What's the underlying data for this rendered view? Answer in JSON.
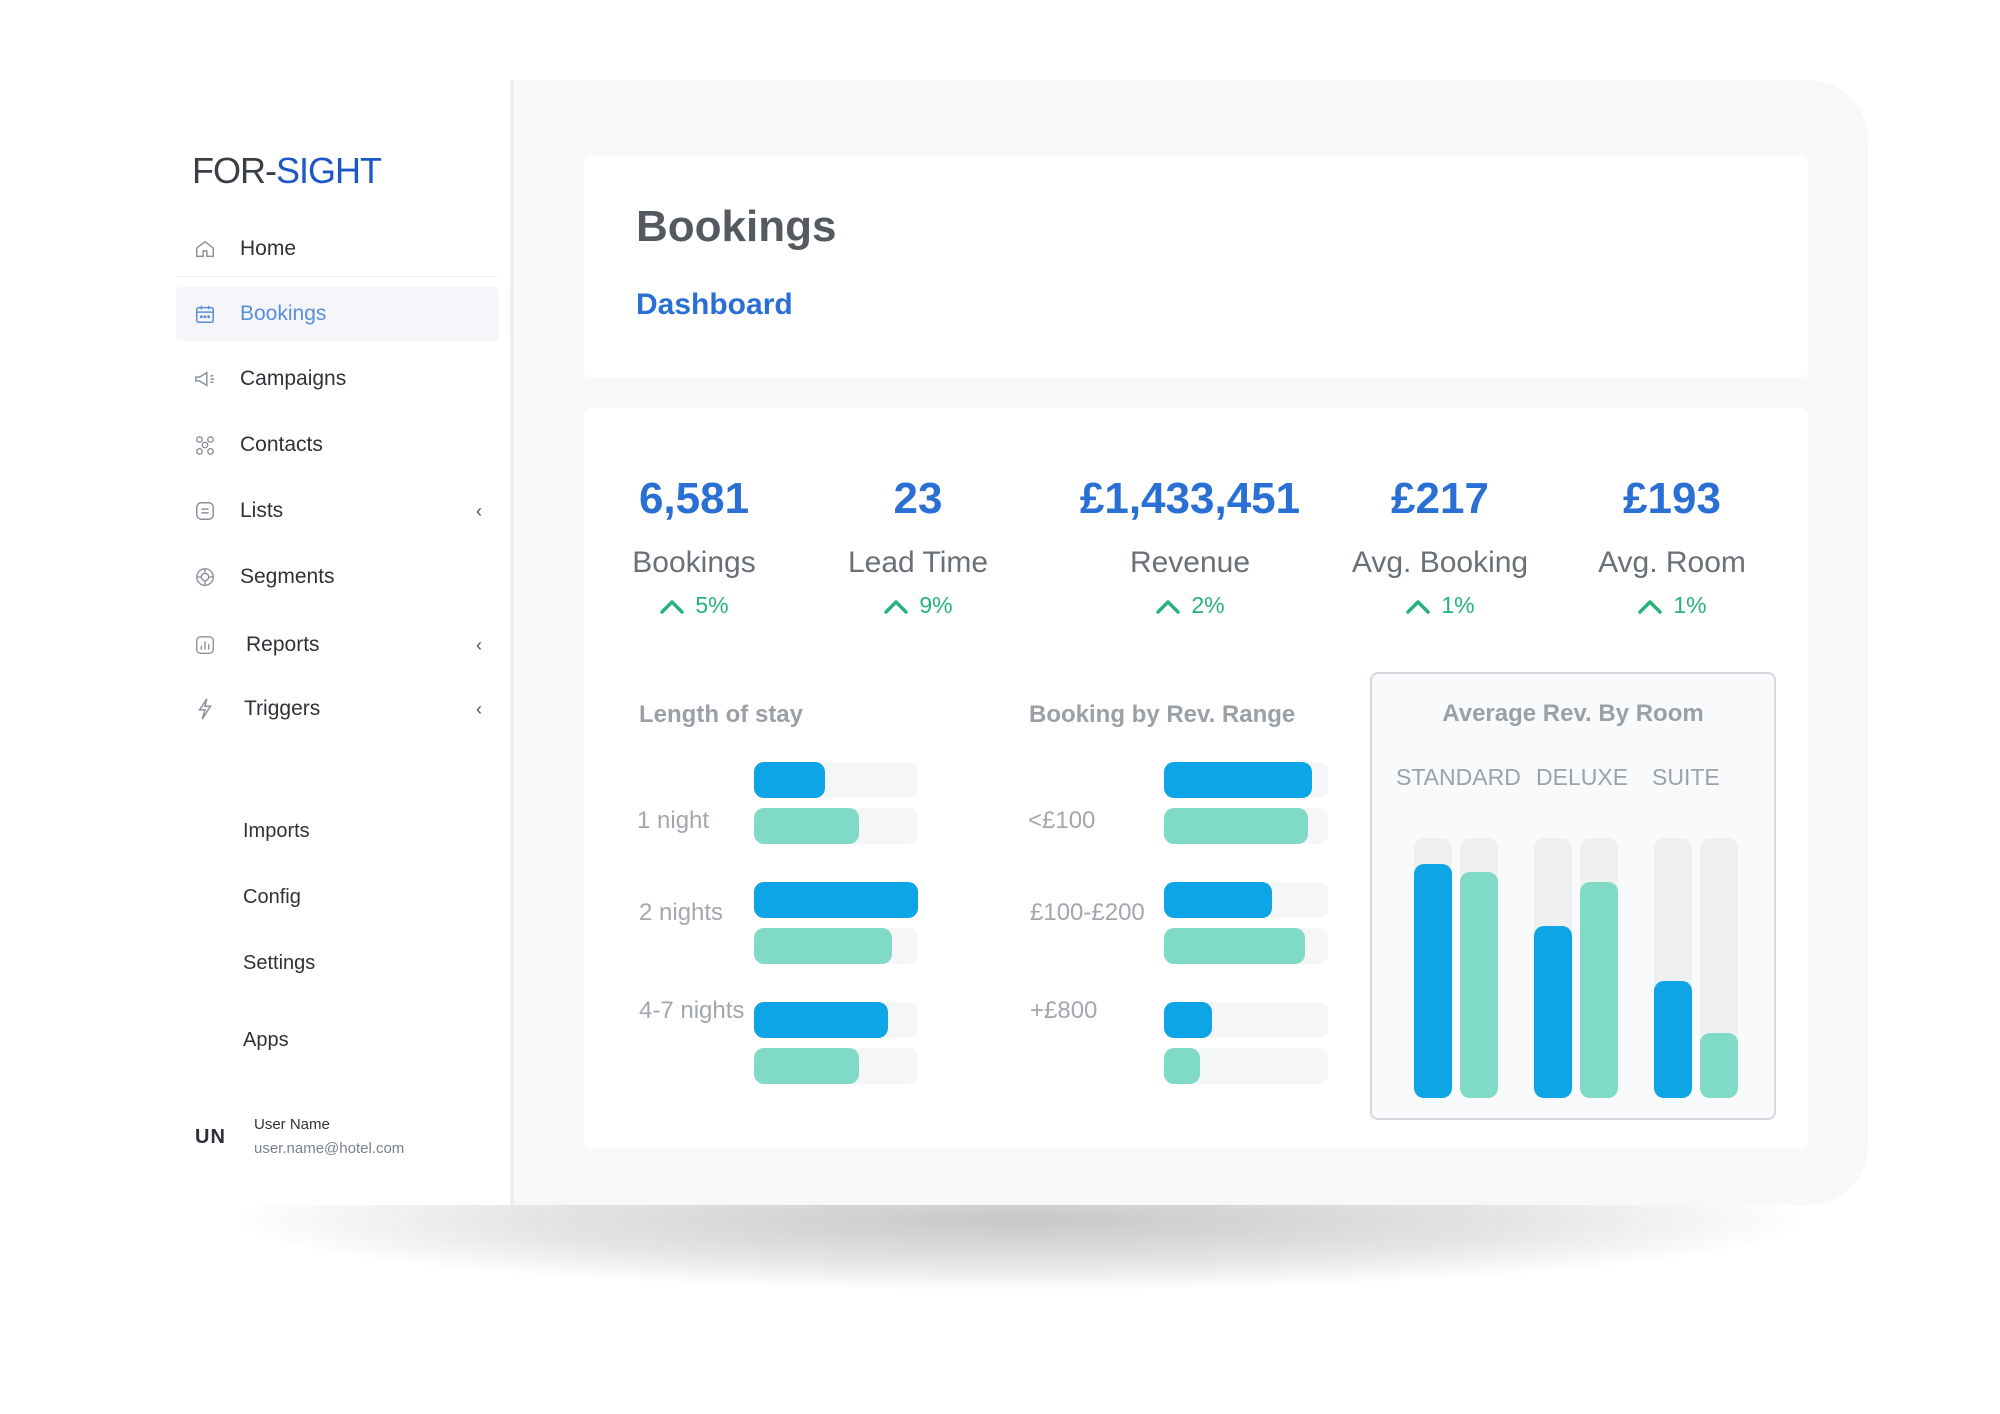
{
  "brand": {
    "part1": "FOR",
    "sep": "-",
    "part2": "SIGHT"
  },
  "nav": [
    {
      "label": "Home",
      "icon": "home-icon",
      "active": false,
      "chevron": false
    },
    {
      "label": "Bookings",
      "icon": "calendar-icon",
      "active": true,
      "chevron": false
    },
    {
      "label": "Campaigns",
      "icon": "megaphone-icon",
      "active": false,
      "chevron": false
    },
    {
      "label": "Contacts",
      "icon": "contacts-icon",
      "active": false,
      "chevron": false
    },
    {
      "label": "Lists",
      "icon": "list-icon",
      "active": false,
      "chevron": true
    },
    {
      "label": "Segments",
      "icon": "segments-icon",
      "active": false,
      "chevron": false
    },
    {
      "label": "Reports",
      "icon": "reports-icon",
      "active": false,
      "chevron": true
    },
    {
      "label": "Triggers",
      "icon": "lightning-icon",
      "active": false,
      "chevron": true
    }
  ],
  "nav_secondary": [
    "Imports",
    "Config",
    "Settings",
    "Apps"
  ],
  "chevron_glyph": "‹",
  "user": {
    "initials": "UN",
    "name": "User Name",
    "email": "user.name@hotel.com"
  },
  "header": {
    "title": "Bookings",
    "subtitle": "Dashboard"
  },
  "kpis": [
    {
      "value": "6,581",
      "label": "Bookings",
      "delta": "5%"
    },
    {
      "value": "23",
      "label": "Lead Time",
      "delta": "9%"
    },
    {
      "value": "£1,433,451",
      "label": "Revenue",
      "delta": "2%"
    },
    {
      "value": "£217",
      "label": "Avg. Booking",
      "delta": "1%"
    },
    {
      "value": "£193",
      "label": "Avg. Room",
      "delta": "1%"
    }
  ],
  "colors": {
    "accent": "#2a6fd4",
    "blue": "#0da5e6",
    "teal": "#7fdbc6",
    "positive": "#26b37a"
  },
  "chart_data": [
    {
      "type": "bar",
      "orientation": "horizontal",
      "title": "Length of stay",
      "categories": [
        "1 night",
        "2 nights",
        "4-7 nights"
      ],
      "series": [
        {
          "values": [
            0.43,
            1.0,
            0.82
          ]
        },
        {
          "values": [
            0.64,
            0.84,
            0.64
          ]
        }
      ],
      "xlim": [
        0,
        1
      ]
    },
    {
      "type": "bar",
      "orientation": "horizontal",
      "title": "Booking by Rev. Range",
      "categories": [
        "<£100",
        "£100-£200",
        "+£800"
      ],
      "series": [
        {
          "values": [
            0.9,
            0.66,
            0.29
          ]
        },
        {
          "values": [
            0.88,
            0.86,
            0.16
          ]
        }
      ],
      "xlim": [
        0,
        1
      ]
    },
    {
      "type": "bar",
      "orientation": "vertical",
      "title": "Average Rev. By Room",
      "categories": [
        "STANDARD",
        "DELUXE",
        "SUITE"
      ],
      "series": [
        {
          "values": [
            0.9,
            0.66,
            0.45
          ]
        },
        {
          "values": [
            0.87,
            0.83,
            0.25
          ]
        }
      ],
      "ylim": [
        0,
        1
      ]
    }
  ]
}
